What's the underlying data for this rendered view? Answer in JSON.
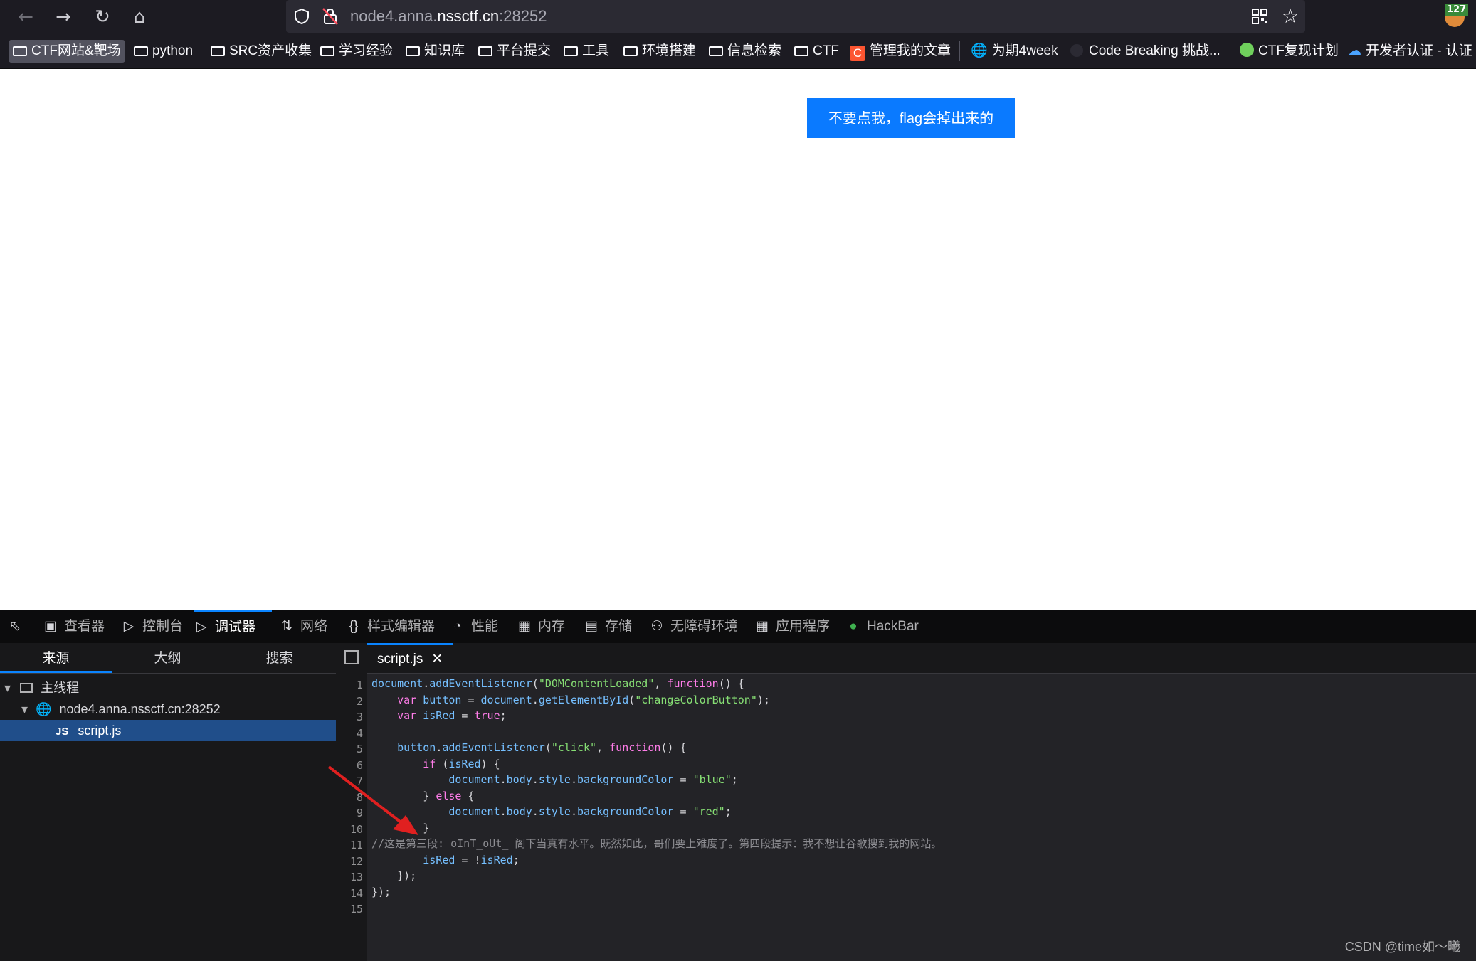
{
  "browser": {
    "url_host_prefix": "node4.anna.",
    "url_host_main": "nssctf.cn",
    "url_port": ":28252",
    "badge_count": "127",
    "bookmarks": [
      "CTF网站&靶场",
      "python",
      "SRC资产收集",
      "学习经验",
      "知识库",
      "平台提交",
      "工具",
      "环境搭建",
      "信息检索",
      "CTF",
      "管理我的文章",
      "为期4week",
      "Code Breaking 挑战...",
      "CTF复现计划",
      "开发者认证 - 认证"
    ]
  },
  "page": {
    "button_label": "不要点我，flag会掉出来的"
  },
  "devtools": {
    "tabs": [
      "查看器",
      "控制台",
      "调试器",
      "网络",
      "样式编辑器",
      "性能",
      "内存",
      "存储",
      "无障碍环境",
      "应用程序",
      "HackBar"
    ],
    "active_tab": "调试器",
    "sources_tabs": [
      "来源",
      "大纲",
      "搜索"
    ],
    "tree": {
      "thread": "主线程",
      "host": "node4.anna.nssctf.cn:28252",
      "file": "script.js"
    },
    "editor_tab": "script.js",
    "line_numbers": [
      "1",
      "2",
      "3",
      "4",
      "5",
      "6",
      "7",
      "8",
      "9",
      "10",
      "11",
      "12",
      "13",
      "14",
      "15"
    ],
    "code_lines": [
      "document.addEventListener(\"DOMContentLoaded\", function() {",
      "    var button = document.getElementById(\"changeColorButton\");",
      "    var isRed = true;",
      "",
      "    button.addEventListener(\"click\", function() {",
      "        if (isRed) {",
      "            document.body.style.backgroundColor = \"blue\";",
      "        } else {",
      "            document.body.style.backgroundColor = \"red\";",
      "        }",
      "//这是第三段: oInT_oUt_ 阁下当真有水平。既然如此，哥们要上难度了。第四段提示：我不想让谷歌搜到我的网站。",
      "        isRed = !isRed;",
      "    });",
      "});",
      ""
    ]
  },
  "watermark": "CSDN @time如～曦"
}
